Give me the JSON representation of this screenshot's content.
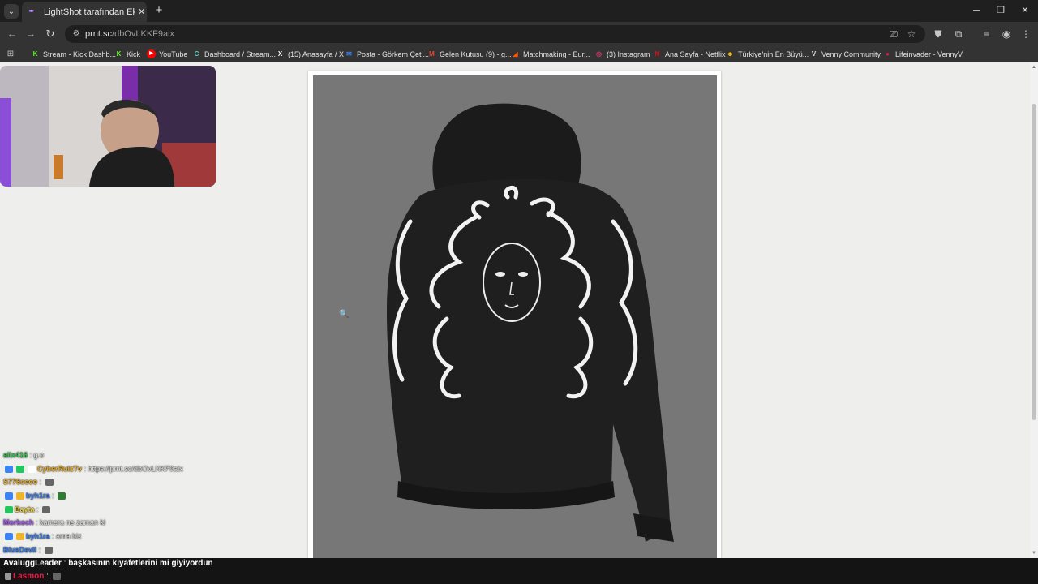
{
  "browser": {
    "tab": {
      "title": "LightShot tarafından Ekran Görüntüsü"
    },
    "url": {
      "host": "prnt.sc",
      "path": "/dbOvLKKF9aix"
    },
    "bookmarks": [
      {
        "label": "Stream - Kick Dashb...",
        "icon": "K",
        "color": "#53fc18"
      },
      {
        "label": "Kick",
        "icon": "K",
        "color": "#53fc18"
      },
      {
        "label": "YouTube",
        "icon": "▶",
        "color": "#ff0000"
      },
      {
        "label": "Dashboard / Stream...",
        "icon": "C",
        "color": "#4fd1c5"
      },
      {
        "label": "(15) Anasayfa / X",
        "icon": "X",
        "color": "#ffffff"
      },
      {
        "label": "Posta - Görkem Çeti...",
        "icon": "✉",
        "color": "#3b82f6"
      },
      {
        "label": "Gelen Kutusu (9) - g...",
        "icon": "M",
        "color": "#ea4335"
      },
      {
        "label": "Matchmaking - Eur...",
        "icon": "◢",
        "color": "#ff5500"
      },
      {
        "label": "(3) Instagram",
        "icon": "◎",
        "color": "#e1306c"
      },
      {
        "label": "Ana Sayfa - Netflix",
        "icon": "N",
        "color": "#e50914"
      },
      {
        "label": "Türkiye'nin En Büyü...",
        "icon": "☻",
        "color": "#f5c518"
      },
      {
        "label": "Venny Community",
        "icon": "V",
        "color": "#dddddd"
      },
      {
        "label": "Lifeinvader - VennyV",
        "icon": "●",
        "color": "#e11d48"
      }
    ]
  },
  "chat": {
    "messages": [
      {
        "user": "alix416",
        "text": "g.o",
        "color": "#3ecf5a"
      },
      {
        "user": "CyberRulzTv",
        "text": "https://prnt.sc/dbOvLKKF9aix",
        "color": "#f0b429"
      },
      {
        "user": "S776coco",
        "text": "",
        "color": "#f0b429"
      },
      {
        "user": "byh1ra",
        "text": "",
        "color": "#3b82f6"
      },
      {
        "user": "Bayta",
        "text": "",
        "color": "#f0d43a"
      },
      {
        "user": "Morkoch",
        "text": "kamera ne zaman ki",
        "color": "#a855f7"
      },
      {
        "user": "byh1ra",
        "text": "ama biz",
        "color": "#3b82f6"
      },
      {
        "user": "BlueDevil",
        "text": "",
        "color": "#3b82f6"
      }
    ],
    "bottom": [
      {
        "user": "AvaluggLeader",
        "text": "başkasının kıyafetlerini mi giyiyordun",
        "color": "#ffffff"
      },
      {
        "user": "Lasmon",
        "text": "",
        "color": "#e11d48"
      }
    ]
  }
}
